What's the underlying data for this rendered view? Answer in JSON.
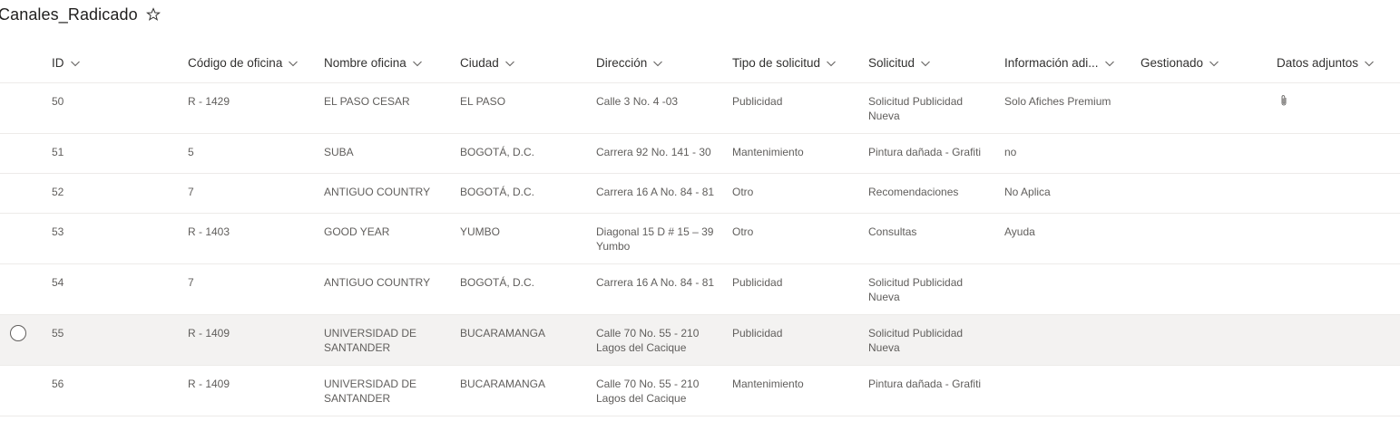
{
  "list": {
    "title": "Canales_Radicado",
    "favorite_icon": "star-outline-icon"
  },
  "columns": [
    {
      "key": "id",
      "label": "ID"
    },
    {
      "key": "codigo",
      "label": "Código de oficina"
    },
    {
      "key": "nombre",
      "label": "Nombre oficina"
    },
    {
      "key": "ciudad",
      "label": "Ciudad"
    },
    {
      "key": "direccion",
      "label": "Dirección"
    },
    {
      "key": "tipo",
      "label": "Tipo de solicitud"
    },
    {
      "key": "solicitud",
      "label": "Solicitud"
    },
    {
      "key": "info",
      "label": "Información adi..."
    },
    {
      "key": "gestionado",
      "label": "Gestionado"
    },
    {
      "key": "adjuntos",
      "label": "Datos adjuntos"
    }
  ],
  "rows": [
    {
      "id": "50",
      "codigo": "R - 1429",
      "nombre": "EL PASO CESAR",
      "ciudad": "EL PASO",
      "direccion": "Calle 3 No. 4 -03",
      "tipo": "Publicidad",
      "solicitud": "Solicitud Publicidad Nueva",
      "info": "Solo Afiches Premium",
      "gestionado": "",
      "adjuntos": "paperclip-icon"
    },
    {
      "id": "51",
      "codigo": "5",
      "nombre": "SUBA",
      "ciudad": "BOGOTÁ, D.C.",
      "direccion": "Carrera 92 No. 141 - 30",
      "tipo": "Mantenimiento",
      "solicitud": "Pintura dañada - Grafiti",
      "info": "no",
      "gestionado": "",
      "adjuntos": ""
    },
    {
      "id": "52",
      "codigo": "7",
      "nombre": "ANTIGUO COUNTRY",
      "ciudad": "BOGOTÁ, D.C.",
      "direccion": "Carrera 16 A No. 84 - 81",
      "tipo": "Otro",
      "solicitud": "Recomendaciones",
      "info": "No Aplica",
      "gestionado": "",
      "adjuntos": ""
    },
    {
      "id": "53",
      "codigo": "R - 1403",
      "nombre": "GOOD YEAR",
      "ciudad": "YUMBO",
      "direccion": "Diagonal 15 D # 15 – 39 Yumbo",
      "tipo": "Otro",
      "solicitud": "Consultas",
      "info": "Ayuda",
      "gestionado": "",
      "adjuntos": ""
    },
    {
      "id": "54",
      "codigo": "7",
      "nombre": "ANTIGUO COUNTRY",
      "ciudad": "BOGOTÁ, D.C.",
      "direccion": "Carrera 16 A No. 84 - 81",
      "tipo": "Publicidad",
      "solicitud": "Solicitud Publicidad Nueva",
      "info": "",
      "gestionado": "",
      "adjuntos": ""
    },
    {
      "id": "55",
      "codigo": "R - 1409",
      "nombre": "UNIVERSIDAD DE SANTANDER",
      "ciudad": "BUCARAMANGA",
      "direccion": "Calle 70 No. 55 - 210 Lagos del Cacique",
      "tipo": "Publicidad",
      "solicitud": "Solicitud Publicidad Nueva",
      "info": "",
      "gestionado": "",
      "adjuntos": ""
    },
    {
      "id": "56",
      "codigo": "R - 1409",
      "nombre": "UNIVERSIDAD DE SANTANDER",
      "ciudad": "BUCARAMANGA",
      "direccion": "Calle 70 No. 55 - 210 Lagos del Cacique",
      "tipo": "Mantenimiento",
      "solicitud": "Pintura dañada - Grafiti",
      "info": "",
      "gestionado": "",
      "adjuntos": ""
    }
  ],
  "colors": {
    "header_text": "#323130",
    "cell_text": "#605e5c",
    "divider": "#edebe9",
    "hover_row": "#f3f2f1"
  }
}
